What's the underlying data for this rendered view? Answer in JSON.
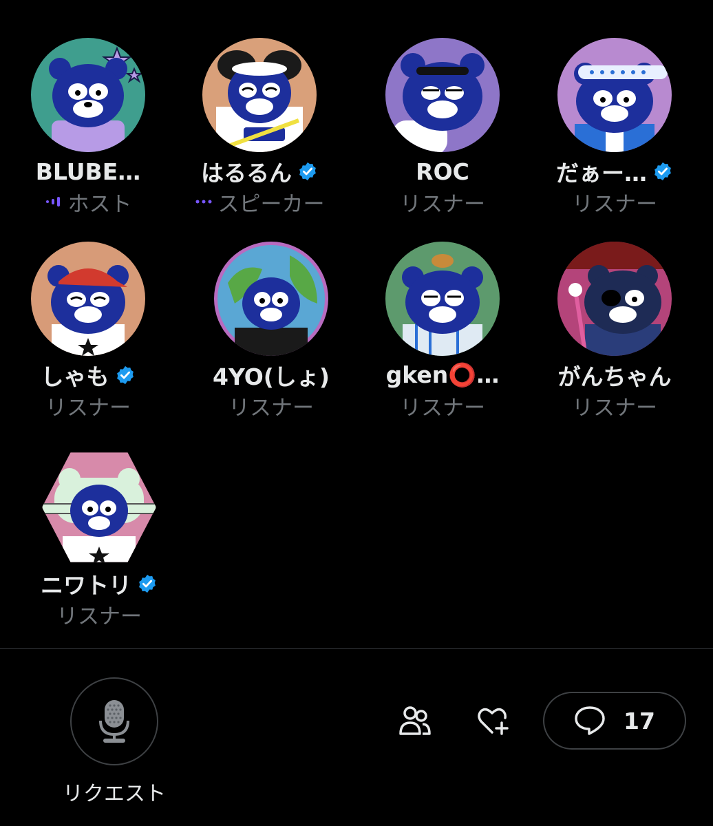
{
  "participants": [
    {
      "name": "BLUBE…",
      "role": "ホスト",
      "verified": false,
      "indicator": "speaking-bars-icon",
      "bg": "#3f9e8e",
      "accent": "#b79be6"
    },
    {
      "name": "はるるん",
      "role": "スピーカー",
      "verified": true,
      "indicator": "dots-icon",
      "bg": "#d9a07a",
      "accent": "#1a1a1a"
    },
    {
      "name": "ROC",
      "role": "リスナー",
      "verified": false,
      "indicator": null,
      "bg": "#8e76c8",
      "accent": "#ffffff"
    },
    {
      "name": "だぁー…",
      "role": "リスナー",
      "verified": true,
      "indicator": null,
      "bg": "#b88ad0",
      "accent": "#2a6fd6"
    },
    {
      "name": "しゃも",
      "role": "リスナー",
      "verified": true,
      "indicator": null,
      "bg": "#d79b78",
      "accent": "#d23a2e"
    },
    {
      "name": "4YO(しょ)",
      "role": "リスナー",
      "verified": false,
      "indicator": null,
      "bg": "#5aa7d4",
      "accent": "#58a846"
    },
    {
      "name": "gken⭕…",
      "role": "リスナー",
      "verified": false,
      "indicator": null,
      "bg": "#5d9a6d",
      "accent": "#9ec3e0"
    },
    {
      "name": "がんちゃん",
      "role": "リスナー",
      "verified": false,
      "indicator": null,
      "bg": "#b4447a",
      "accent": "#1e2b55"
    },
    {
      "name": "ニワトリ",
      "role": "リスナー",
      "verified": true,
      "indicator": null,
      "bg": "#d78aaa",
      "accent": "#d9f1dc"
    }
  ],
  "controls": {
    "request_label": "リクエスト",
    "comment_count": "17",
    "mic_icon": "microphone-icon",
    "people_icon": "people-icon",
    "heart_icon": "heart-plus-icon",
    "comment_icon": "comment-bubble-icon"
  },
  "colors": {
    "verified": "#1d9bf0",
    "indicator": "#7856ff",
    "muted_text": "#71767b"
  }
}
